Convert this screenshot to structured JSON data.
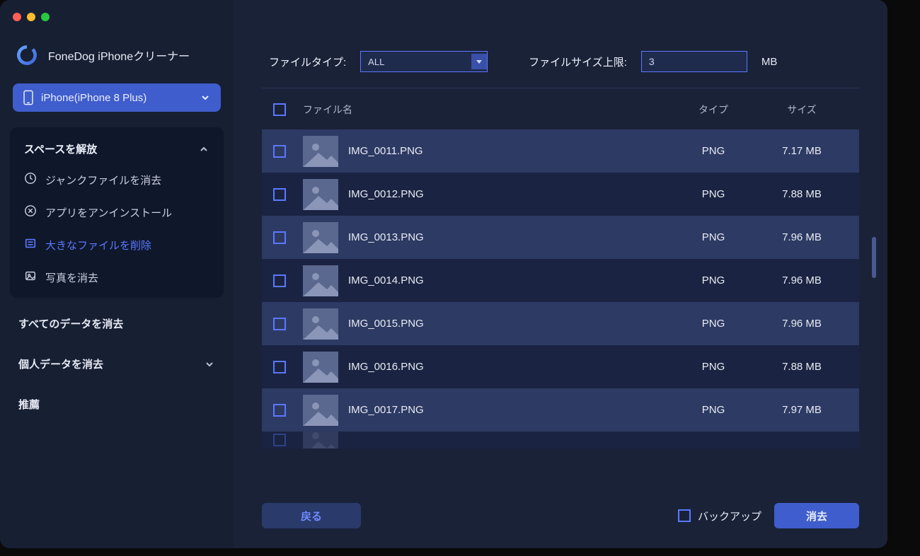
{
  "app": {
    "title": "FoneDog iPhoneクリーナー"
  },
  "device": {
    "label": "iPhone(iPhone 8 Plus)"
  },
  "sidebar": {
    "section_free_space": "スペースを解放",
    "items": [
      {
        "label": "ジャンクファイルを消去"
      },
      {
        "label": "アプリをアンインストール"
      },
      {
        "label": "大きなファイルを削除"
      },
      {
        "label": "写真を消去"
      }
    ],
    "erase_all": "すべてのデータを消去",
    "erase_private": "個人データを消去",
    "recommend": "推薦"
  },
  "filters": {
    "type_label": "ファイルタイプ:",
    "type_value": "ALL",
    "size_label": "ファイルサイズ上限:",
    "size_value": "3",
    "size_unit": "MB"
  },
  "table": {
    "headers": {
      "name": "ファイル名",
      "type": "タイプ",
      "size": "サイズ"
    },
    "rows": [
      {
        "name": "IMG_0011.PNG",
        "type": "PNG",
        "size": "7.17 MB"
      },
      {
        "name": "IMG_0012.PNG",
        "type": "PNG",
        "size": "7.88 MB"
      },
      {
        "name": "IMG_0013.PNG",
        "type": "PNG",
        "size": "7.96 MB"
      },
      {
        "name": "IMG_0014.PNG",
        "type": "PNG",
        "size": "7.96 MB"
      },
      {
        "name": "IMG_0015.PNG",
        "type": "PNG",
        "size": "7.96 MB"
      },
      {
        "name": "IMG_0016.PNG",
        "type": "PNG",
        "size": "7.88 MB"
      },
      {
        "name": "IMG_0017.PNG",
        "type": "PNG",
        "size": "7.97 MB"
      }
    ]
  },
  "footer": {
    "back": "戻る",
    "backup": "バックアップ",
    "erase": "消去"
  }
}
